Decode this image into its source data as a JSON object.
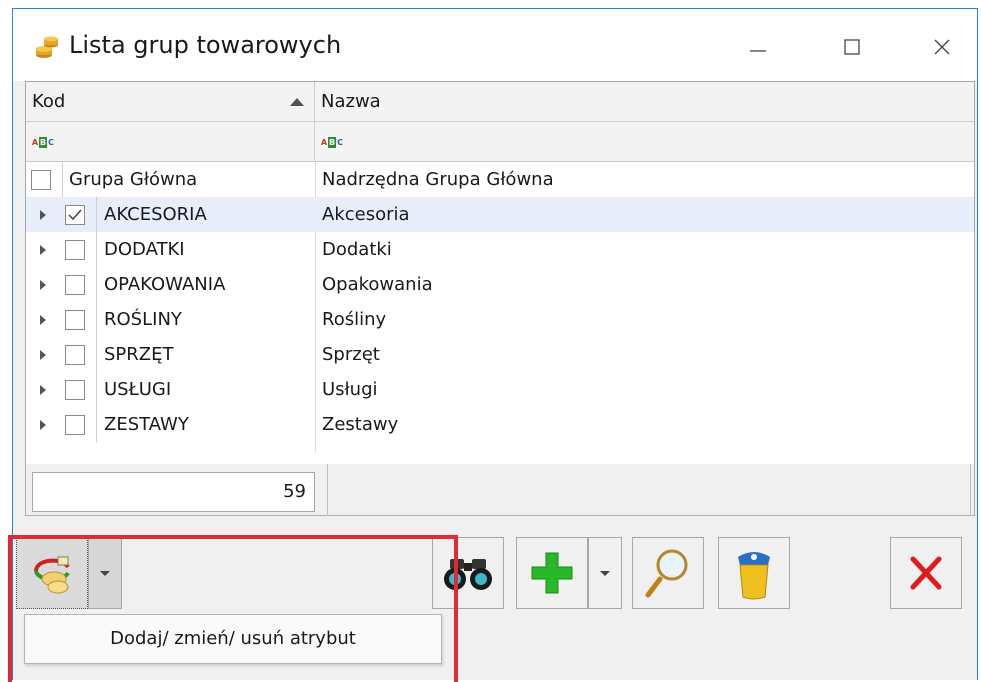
{
  "window": {
    "title": "Lista grup towarowych"
  },
  "grid": {
    "columns": [
      "Kod",
      "Nazwa"
    ],
    "root": {
      "kod": "Grupa Główna",
      "nazwa": "Nadrzędna Grupa Główna"
    },
    "rows": [
      {
        "kod": "AKCESORIA",
        "nazwa": "Akcesoria",
        "checked": true,
        "selected": true
      },
      {
        "kod": "DODATKI",
        "nazwa": "Dodatki",
        "checked": false
      },
      {
        "kod": "OPAKOWANIA",
        "nazwa": "Opakowania",
        "checked": false
      },
      {
        "kod": "ROŚLINY",
        "nazwa": "Rośliny",
        "checked": false
      },
      {
        "kod": "SPRZĘT",
        "nazwa": "Sprzęt",
        "checked": false
      },
      {
        "kod": "USŁUGI",
        "nazwa": "Usługi",
        "checked": false
      },
      {
        "kod": "ZESTAWY",
        "nazwa": "Zestawy",
        "checked": false
      }
    ]
  },
  "status": {
    "count": "59"
  },
  "popup": {
    "label": "Dodaj/ zmień/ usuń atrybut"
  },
  "colors": {
    "accent_border": "#1e88d4",
    "highlight": "#e02a35",
    "add_green": "#28b829",
    "close_red": "#e01b1b",
    "selected_row": "#e8eef9"
  },
  "icons": {
    "app": "gold-coins-icon",
    "attribute": "attribute-edit-icon",
    "find": "binoculars-icon",
    "add": "green-plus-icon",
    "zoom": "magnifier-icon",
    "delete": "trash-bin-icon",
    "close": "red-x-icon"
  }
}
